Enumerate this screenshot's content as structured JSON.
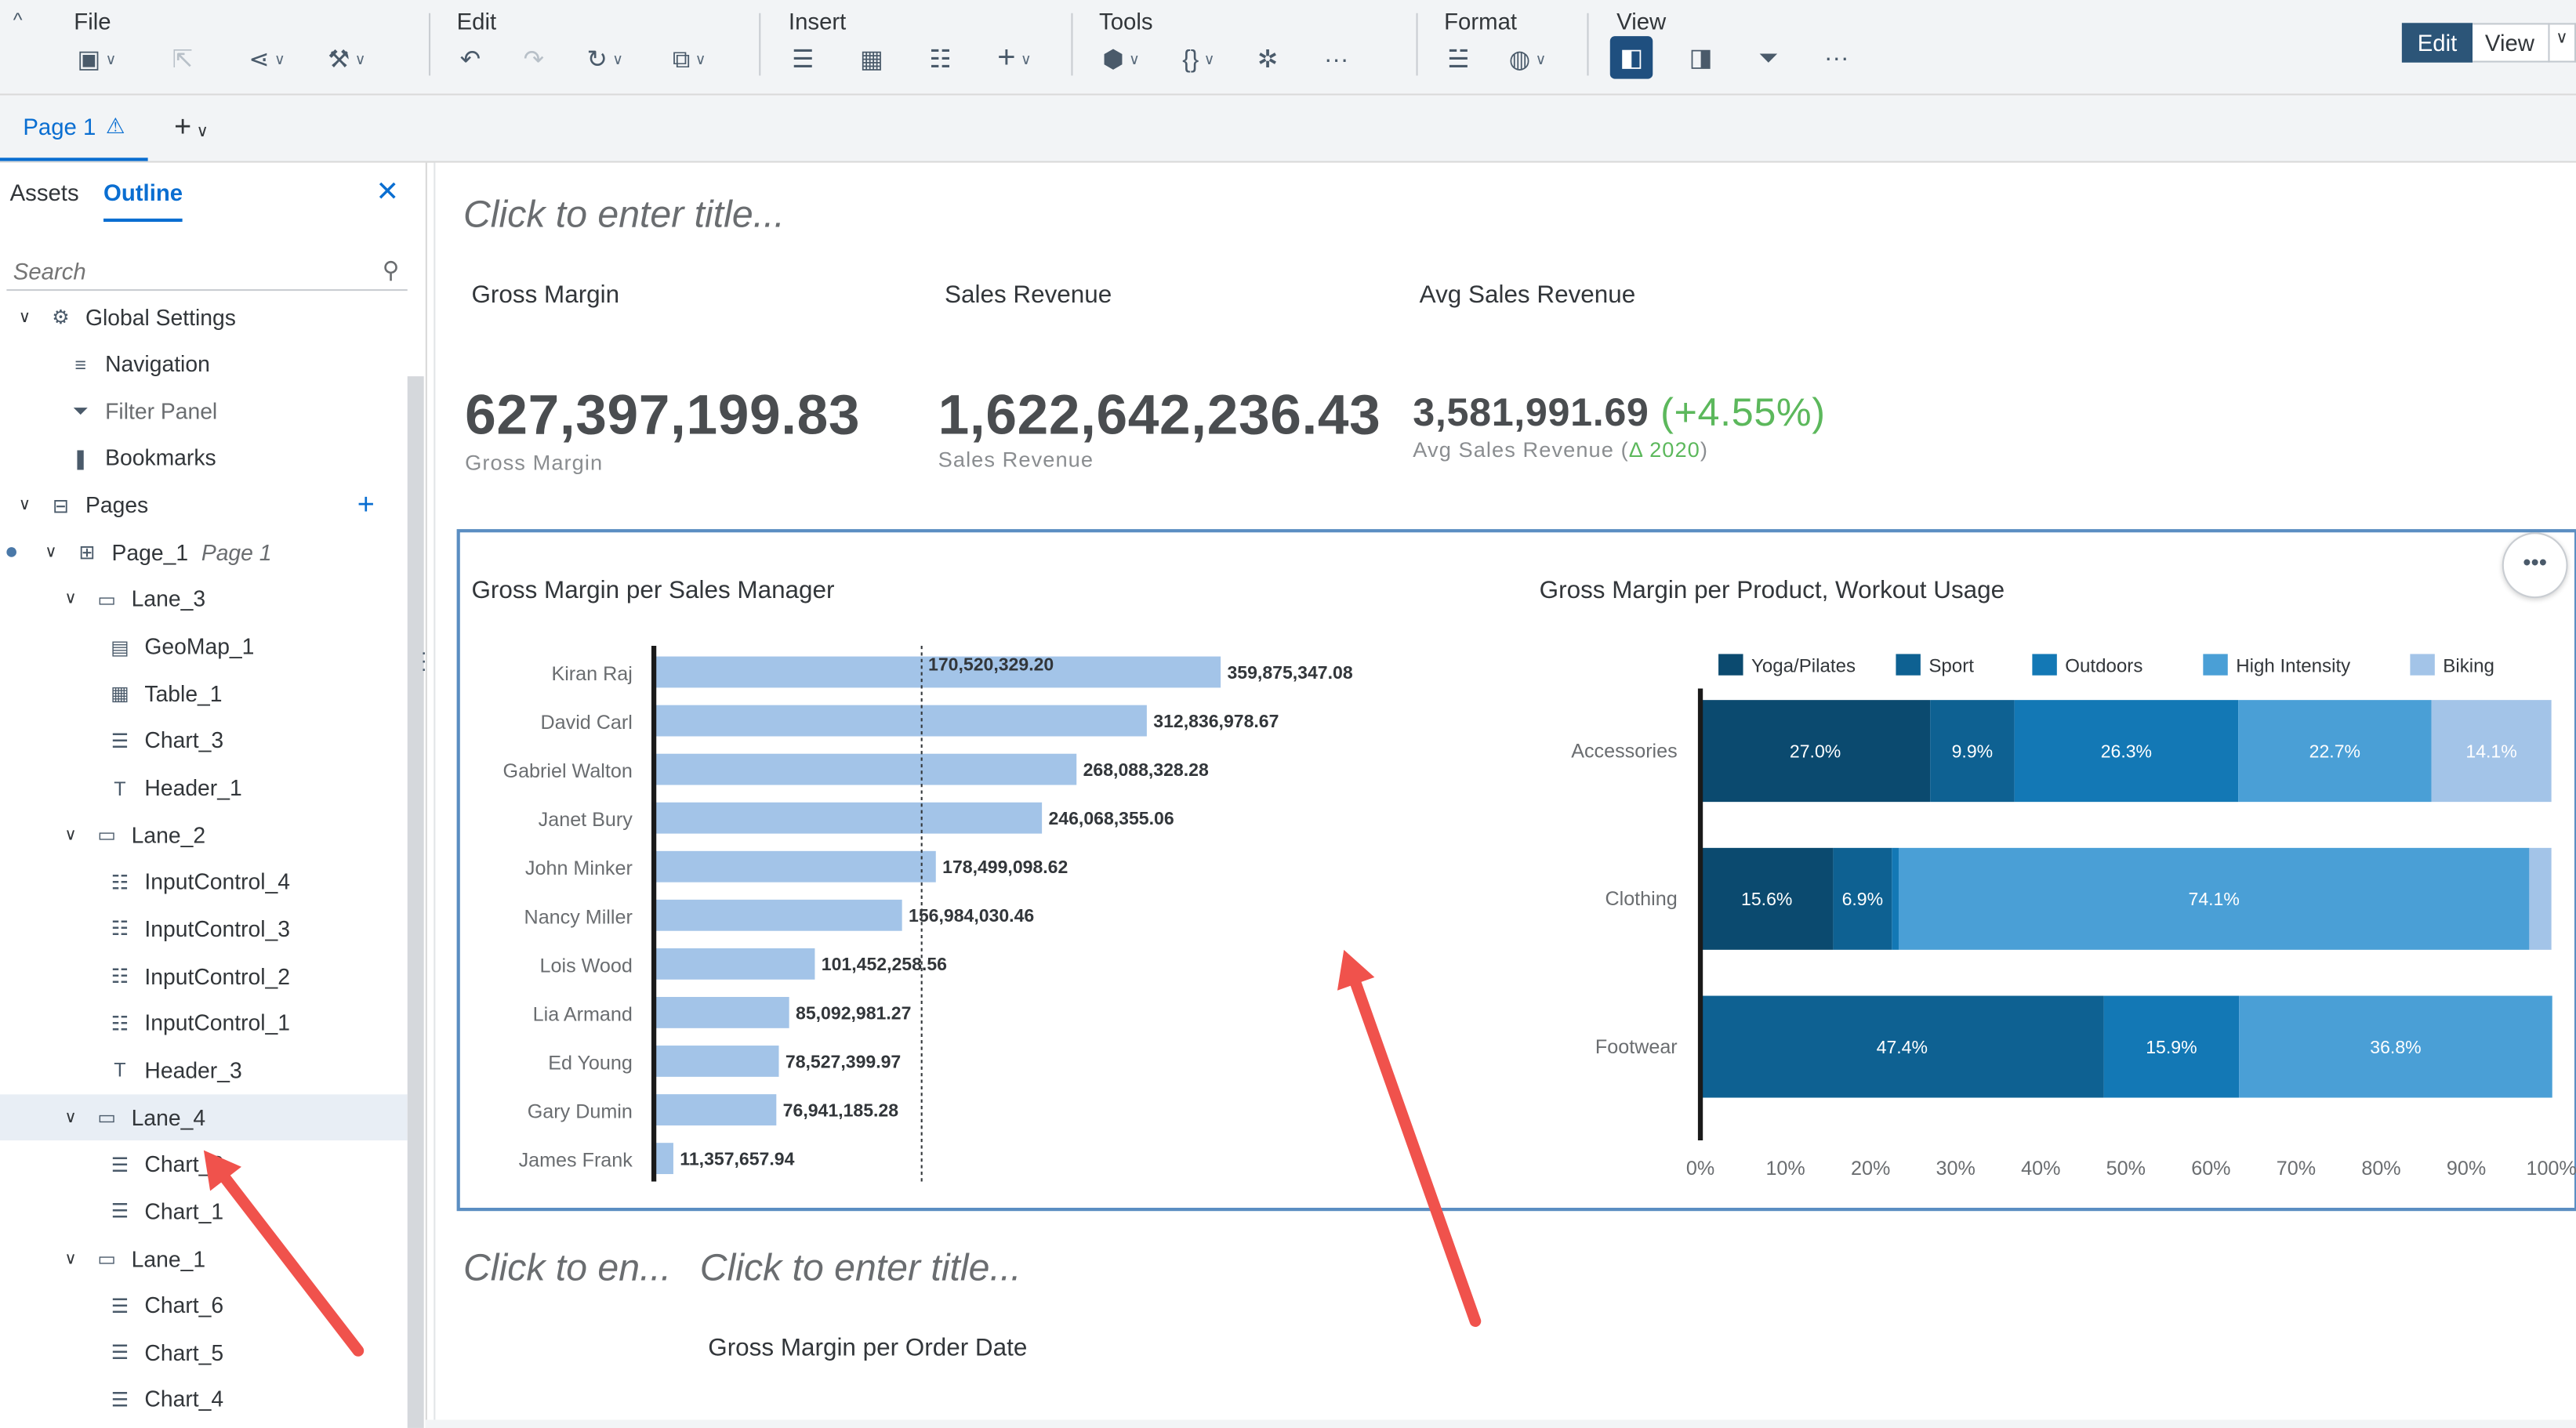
{
  "toolbar": {
    "groups": [
      {
        "label": "File"
      },
      {
        "label": "Edit"
      },
      {
        "label": "Insert"
      },
      {
        "label": "Tools"
      },
      {
        "label": "Format"
      },
      {
        "label": "View"
      }
    ],
    "edit_label": "Edit",
    "view_label": "View"
  },
  "tabs": {
    "page_tab": "Page 1"
  },
  "panel": {
    "tab_assets": "Assets",
    "tab_outline": "Outline",
    "search_placeholder": "Search",
    "tree": [
      {
        "label": "Global Settings",
        "icon": "gear-icon",
        "level": 0,
        "expanded": true
      },
      {
        "label": "Navigation",
        "icon": "menu-icon",
        "level": 1
      },
      {
        "label": "Filter Panel",
        "icon": "filter-icon",
        "level": 1,
        "greyed": true
      },
      {
        "label": "Bookmarks",
        "icon": "bookmark-icon",
        "level": 1
      },
      {
        "label": "Pages",
        "icon": "pages-icon",
        "level": 0,
        "expanded": true
      },
      {
        "label": "Page_1",
        "sub": "Page 1",
        "icon": "page-icon",
        "level": 1,
        "expanded": true
      },
      {
        "label": "Lane_3",
        "icon": "lane-icon",
        "level": 2,
        "expanded": true
      },
      {
        "label": "GeoMap_1",
        "icon": "geomap-icon",
        "level": 3
      },
      {
        "label": "Table_1",
        "icon": "table-icon",
        "level": 3
      },
      {
        "label": "Chart_3",
        "icon": "chart-icon",
        "level": 3
      },
      {
        "label": "Header_1",
        "icon": "text-icon",
        "level": 3
      },
      {
        "label": "Lane_2",
        "icon": "lane-icon",
        "level": 2,
        "expanded": true
      },
      {
        "label": "InputControl_4",
        "icon": "input-control-icon",
        "level": 3
      },
      {
        "label": "InputControl_3",
        "icon": "input-control-icon",
        "level": 3
      },
      {
        "label": "InputControl_2",
        "icon": "input-control-icon",
        "level": 3
      },
      {
        "label": "InputControl_1",
        "icon": "input-control-icon",
        "level": 3
      },
      {
        "label": "Header_3",
        "icon": "text-icon",
        "level": 3
      },
      {
        "label": "Lane_4",
        "icon": "lane-icon",
        "level": 2,
        "expanded": true,
        "selected": true
      },
      {
        "label": "Chart_2",
        "icon": "chart-icon",
        "level": 3
      },
      {
        "label": "Chart_1",
        "icon": "chart-icon",
        "level": 3
      },
      {
        "label": "Lane_1",
        "icon": "lane-icon",
        "level": 2,
        "expanded": true
      },
      {
        "label": "Chart_6",
        "icon": "chart-icon",
        "level": 3
      },
      {
        "label": "Chart_5",
        "icon": "chart-icon",
        "level": 3
      },
      {
        "label": "Chart_4",
        "icon": "chart-icon",
        "level": 3
      }
    ]
  },
  "canvas": {
    "title_placeholder": "Click to enter title...",
    "kpis": [
      {
        "title": "Gross Margin",
        "value": "627,397,199.83",
        "sub": "Gross Margin"
      },
      {
        "title": "Sales Revenue",
        "value": "1,622,642,236.43",
        "sub": "Sales Revenue"
      },
      {
        "title": "Avg Sales Revenue",
        "value": "3,581,991.69",
        "change": "(+4.55%)",
        "sub": "Avg Sales Revenue",
        "sub_paren_open": "(",
        "sub_change": "Δ 2020",
        "sub_paren_close": ")"
      }
    ],
    "bottom_title_1": "Click to en...",
    "bottom_title_2": "Click to enter title...",
    "bottom_chart_title": "Gross Margin per Order Date",
    "more_button": "•••"
  },
  "chart_data": [
    {
      "type": "bar",
      "title": "Gross Margin per Sales Manager",
      "orientation": "horizontal",
      "categories": [
        "Kiran Raj",
        "David Carl",
        "Gabriel Walton",
        "Janet Bury",
        "John Minker",
        "Nancy Miller",
        "Lois Wood",
        "Lia Armand",
        "Ed Young",
        "Gary Dumin",
        "James Frank"
      ],
      "values": [
        359875347.08,
        312836978.67,
        268088328.28,
        246068355.06,
        178499098.62,
        156984030.46,
        101452258.56,
        85092981.27,
        78527399.97,
        76941185.28,
        11357657.94
      ],
      "labels": [
        "359,875,347.08",
        "312,836,978.67",
        "268,088,328.28",
        "246,068,355.06",
        "178,499,098.62",
        "156,984,030.46",
        "101,452,258.56",
        "85,092,981.27",
        "78,527,399.97",
        "76,941,185.28",
        "11,357,657.94"
      ],
      "reference_line": {
        "value": 170520329.2,
        "label": "170,520,329.20"
      },
      "color": "#a3c4e8",
      "grid": false
    },
    {
      "type": "bar",
      "title": "Gross Margin per Product, Workout Usage",
      "orientation": "horizontal",
      "stacked": "percent",
      "categories": [
        "Accessories",
        "Clothing",
        "Footwear"
      ],
      "series": [
        {
          "name": "Yoga/Pilates",
          "color": "#0b4a6f",
          "values": [
            27.0,
            15.6,
            0
          ],
          "labels": [
            "27.0%",
            "15.6%",
            ""
          ]
        },
        {
          "name": "Sport",
          "color": "#0e6192",
          "values": [
            9.9,
            6.9,
            47.4
          ],
          "labels": [
            "9.9%",
            "6.9%",
            "47.4%"
          ]
        },
        {
          "name": "Outdoors",
          "color": "#1378b5",
          "values": [
            26.3,
            0.8,
            15.9
          ],
          "labels": [
            "26.3%",
            "",
            "15.9%"
          ]
        },
        {
          "name": "High Intensity",
          "color": "#4a9fd6",
          "values": [
            22.7,
            74.1,
            36.8
          ],
          "labels": [
            "22.7%",
            "74.1%",
            "36.8%"
          ]
        },
        {
          "name": "Biking",
          "color": "#a3c4e8",
          "values": [
            14.1,
            2.6,
            0
          ],
          "labels": [
            "14.1%",
            "",
            ""
          ]
        }
      ],
      "xticks": [
        "0%",
        "10%",
        "20%",
        "30%",
        "40%",
        "50%",
        "60%",
        "70%",
        "80%",
        "90%",
        "100%"
      ],
      "xlim": [
        0,
        100
      ],
      "legend": "top",
      "grid": false
    }
  ]
}
